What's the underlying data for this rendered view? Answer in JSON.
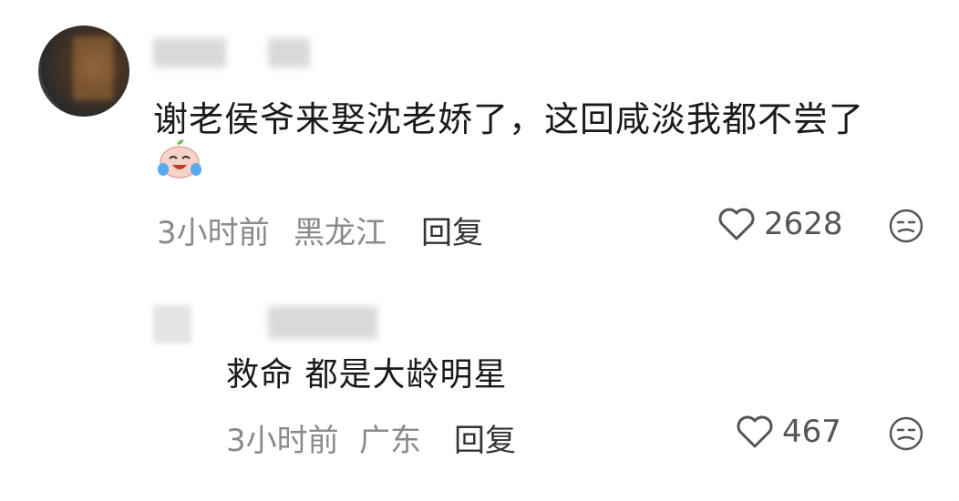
{
  "comment": {
    "text": "谢老侯爷来娶沈老娇了，这回咸淡我都不尝了",
    "emoji_icon": "crying-laughing-face-icon",
    "time": "3小时前",
    "location": "黑龙江",
    "reply_label": "回复",
    "likes": "2628"
  },
  "reply": {
    "text": "救命 都是大龄明星",
    "time": "3小时前",
    "location": "广东",
    "reply_label": "回复",
    "likes": "467"
  }
}
